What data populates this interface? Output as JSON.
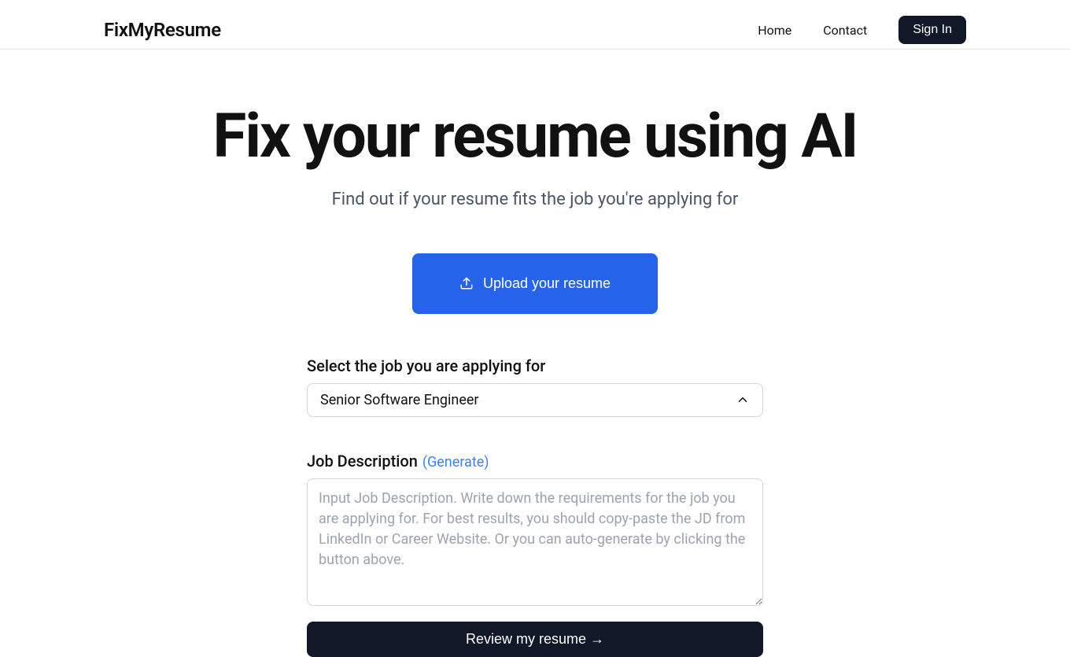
{
  "header": {
    "logo": "FixMyResume",
    "nav": {
      "home": "Home",
      "contact": "Contact",
      "signin": "Sign In"
    }
  },
  "hero": {
    "title": "Fix your resume using AI",
    "subtitle": "Find out if your resume fits the job you're applying for"
  },
  "upload": {
    "label": "Upload your resume"
  },
  "form": {
    "select_label": "Select the job you are applying for",
    "select_value": "Senior Software Engineer",
    "jd_label": "Job Description",
    "generate_label": "(Generate)",
    "jd_placeholder": "Input Job Description. Write down the requirements for the job you are applying for. For best results, you should copy-paste the JD from LinkedIn or Career Website. Or you can auto-generate by clicking the button above.",
    "review_label": "Review my resume →"
  }
}
